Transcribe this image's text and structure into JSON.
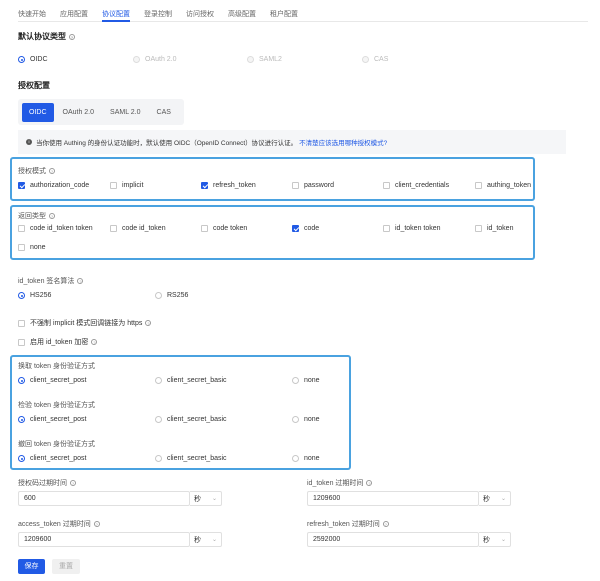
{
  "tabs": [
    "快速开始",
    "应用配置",
    "协议配置",
    "登录控制",
    "访问授权",
    "高级配置",
    "租户配置"
  ],
  "active_tab": 2,
  "default_protocol": {
    "title": "默认协议类型",
    "options": [
      "OIDC",
      "OAuth 2.0",
      "SAML2",
      "CAS"
    ]
  },
  "auth_config": {
    "title": "授权配置",
    "segments": [
      "OIDC",
      "OAuth 2.0",
      "SAML 2.0",
      "CAS"
    ]
  },
  "info": {
    "text": "当你使用 Authing 的身份认证功能时，默认使用 OIDC（OpenID Connect）协议进行认证。",
    "link": "不清楚应该选用哪种授权模式?"
  },
  "grant_types": {
    "label": "授权模式",
    "options": [
      "authorization_code",
      "implicit",
      "refresh_token",
      "password",
      "client_credentials",
      "authing_token"
    ],
    "checked": [
      true,
      false,
      true,
      false,
      false,
      false
    ]
  },
  "response_types": {
    "label": "返回类型",
    "options": [
      "code id_token token",
      "code id_token",
      "code token",
      "code",
      "id_token token",
      "id_token",
      "none"
    ],
    "checked": [
      false,
      false,
      false,
      true,
      false,
      false,
      false
    ]
  },
  "id_token_alg": {
    "label": "id_token 签名算法",
    "options": [
      "HS256",
      "RS256"
    ]
  },
  "checkboxes": {
    "implicit_https": "不强制 implicit 模式回调链接为 https",
    "id_token_encrypt": "启用 id_token 加密"
  },
  "token_auth": {
    "exchange_label": "换取 token 身份验证方式",
    "inspect_label": "检验 token 身份验证方式",
    "revoke_label": "撤回 token 身份验证方式",
    "options": [
      "client_secret_post",
      "client_secret_basic",
      "none"
    ]
  },
  "expiry": {
    "code_label": "授权码过期时间",
    "code_value": "600",
    "id_token_label": "id_token 过期时间",
    "id_token_value": "1209600",
    "access_label": "access_token 过期时间",
    "access_value": "1209600",
    "refresh_label": "refresh_token 过期时间",
    "refresh_value": "2592000",
    "unit": "秒"
  },
  "buttons": {
    "save": "保存",
    "reset": "重置"
  }
}
